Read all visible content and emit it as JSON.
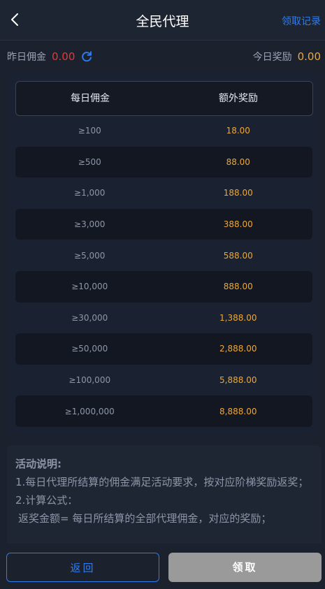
{
  "header": {
    "title": "全民代理",
    "history_label": "领取记录"
  },
  "stats": {
    "yesterday_label": "昨日佣金",
    "yesterday_value": "0.00",
    "today_label": "今日奖励",
    "today_value": "0.00"
  },
  "table": {
    "headers": [
      "每日佣金",
      "额外奖励"
    ],
    "rows": [
      {
        "threshold": "≥100",
        "reward": "18.00"
      },
      {
        "threshold": "≥500",
        "reward": "88.00"
      },
      {
        "threshold": "≥1,000",
        "reward": "188.00"
      },
      {
        "threshold": "≥3,000",
        "reward": "388.00"
      },
      {
        "threshold": "≥5,000",
        "reward": "588.00"
      },
      {
        "threshold": "≥10,000",
        "reward": "888.00"
      },
      {
        "threshold": "≥30,000",
        "reward": "1,388.00"
      },
      {
        "threshold": "≥50,000",
        "reward": "2,888.00"
      },
      {
        "threshold": "≥100,000",
        "reward": "5,888.00"
      },
      {
        "threshold": "≥1,000,000",
        "reward": "8,888.00"
      }
    ]
  },
  "description": {
    "title": "活动说明:",
    "line1": "1.每日代理所结算的佣金满足活动要求，按对应阶梯奖励返奖；",
    "line2": "2.计算公式：",
    "line3": "返奖金额= 每日所结算的全部代理佣金，对应的奖励；"
  },
  "footer": {
    "back_label": "返回",
    "claim_label": "领取"
  },
  "colors": {
    "accent": "#2d7cf0",
    "gold": "#f0a732",
    "red": "#e03b3b"
  }
}
